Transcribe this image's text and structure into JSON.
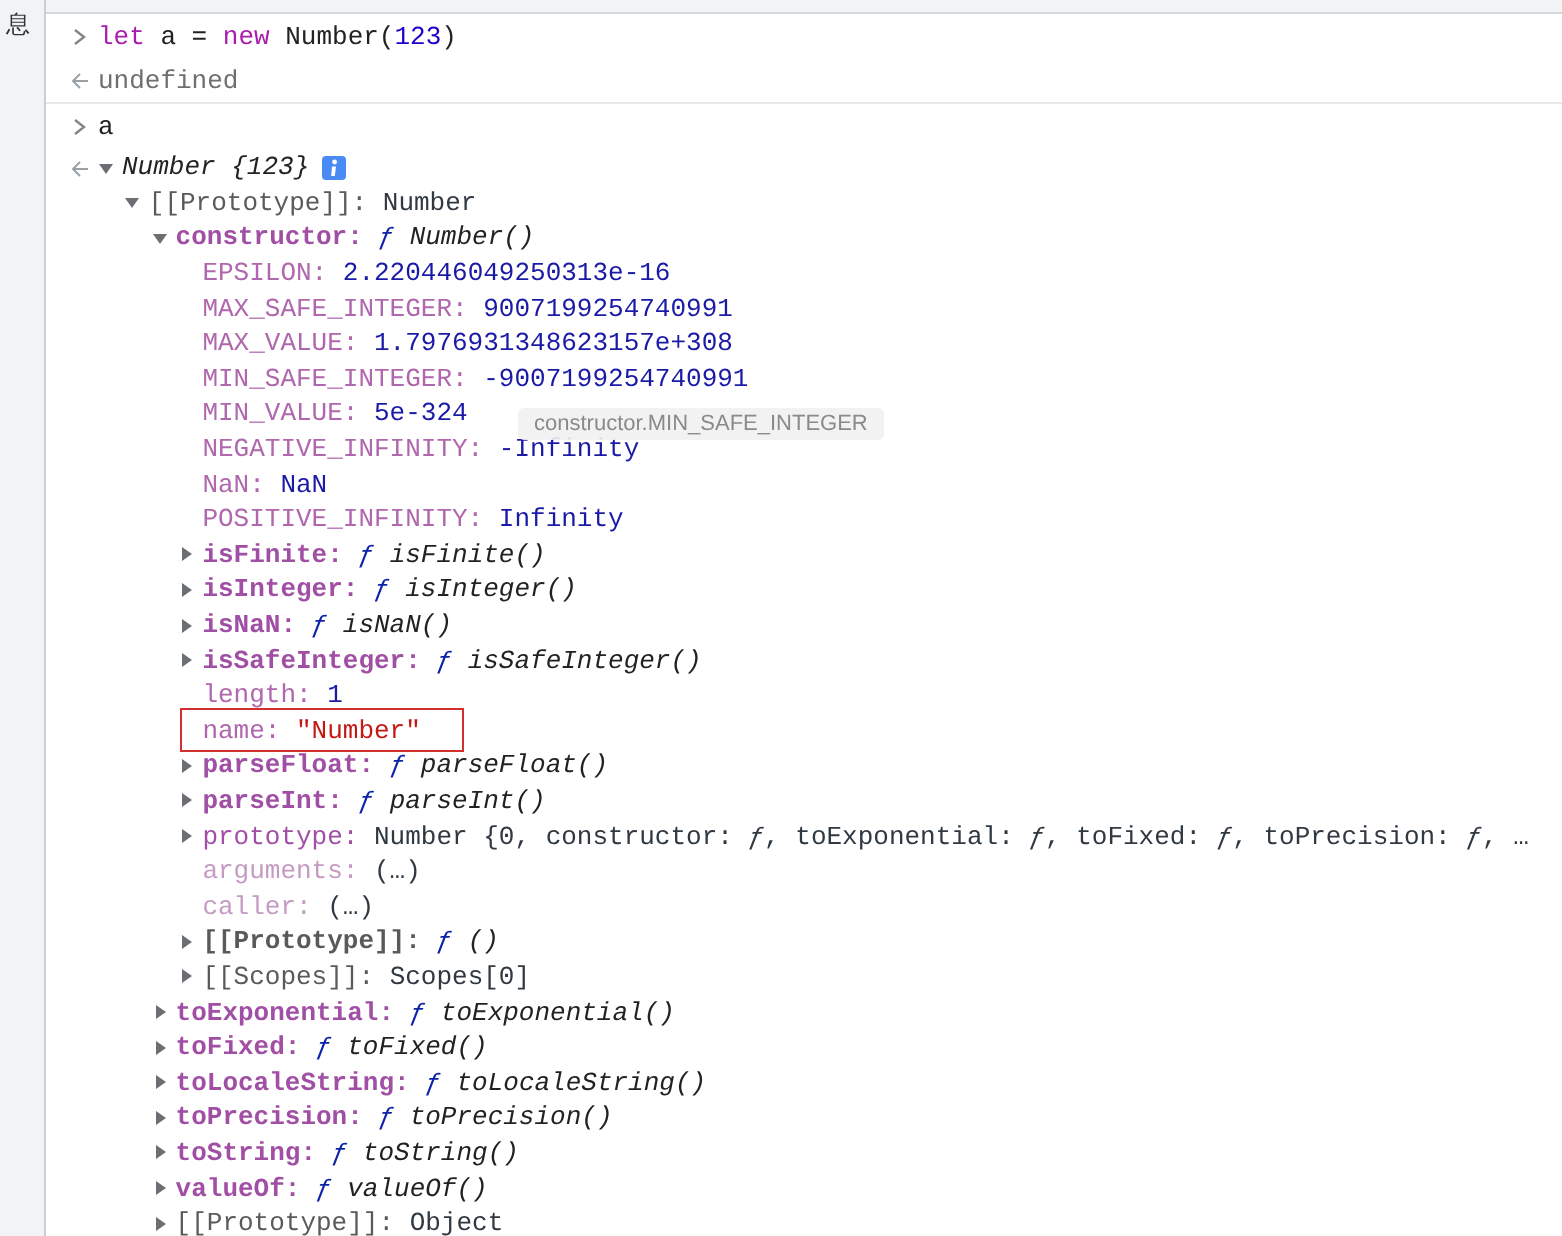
{
  "sidebar": {
    "items": [
      {
        "label": "息"
      }
    ]
  },
  "console": {
    "entries": [
      {
        "kind": "input",
        "tokens": [
          {
            "kind": "keyword",
            "text": "let"
          },
          {
            "kind": "plain",
            "text": " a = "
          },
          {
            "kind": "keyword",
            "text": "new"
          },
          {
            "kind": "plain",
            "text": " Number("
          },
          {
            "kind": "number",
            "text": "123"
          },
          {
            "kind": "plain",
            "text": ")"
          }
        ]
      },
      {
        "kind": "output",
        "text": "undefined"
      },
      {
        "kind": "input",
        "tokens": [
          {
            "kind": "plain",
            "text": "a"
          }
        ]
      },
      {
        "kind": "result",
        "root": {
          "kind": "preview",
          "value": "Number {123}",
          "info": true,
          "expanded": true,
          "highlighted": false,
          "children": [
            {
              "key": "[[Prototype]]:",
              "color": "#5a5a5a",
              "kind": "object",
              "value": "Number",
              "expanded": true,
              "highlighted": false,
              "children": [
                {
                  "key": "constructor:",
                  "color": "#a14fa5",
                  "kind": "function",
                  "prefix": "ƒ",
                  "value": "Number()",
                  "expanded": true,
                  "highlighted": false,
                  "children": [
                    {
                      "key": "EPSILON:",
                      "color": "#b067ad",
                      "kind": "number",
                      "value": "2.220446049250313e-16",
                      "highlighted": false
                    },
                    {
                      "key": "MAX_SAFE_INTEGER:",
                      "color": "#b067ad",
                      "kind": "number",
                      "value": "9007199254740991",
                      "highlighted": false
                    },
                    {
                      "key": "MAX_VALUE:",
                      "color": "#b067ad",
                      "kind": "number",
                      "value": "1.7976931348623157e+308",
                      "highlighted": false
                    },
                    {
                      "key": "MIN_SAFE_INTEGER:",
                      "color": "#b067ad",
                      "kind": "number",
                      "value": "-9007199254740991",
                      "highlighted": false
                    },
                    {
                      "key": "MIN_VALUE:",
                      "color": "#b067ad",
                      "kind": "number",
                      "value": "5e-324",
                      "highlighted": false
                    },
                    {
                      "key": "NEGATIVE_INFINITY:",
                      "color": "#b067ad",
                      "kind": "number",
                      "value": "-Infinity",
                      "highlighted": false
                    },
                    {
                      "key": "NaN:",
                      "color": "#b067ad",
                      "kind": "number",
                      "value": "NaN",
                      "highlighted": false
                    },
                    {
                      "key": "POSITIVE_INFINITY:",
                      "color": "#b067ad",
                      "kind": "number",
                      "value": "Infinity",
                      "highlighted": false
                    },
                    {
                      "key": "isFinite:",
                      "color": "#a14fa5",
                      "kind": "function",
                      "prefix": "ƒ",
                      "value": "isFinite()",
                      "expanded": false,
                      "highlighted": false
                    },
                    {
                      "key": "isInteger:",
                      "color": "#a14fa5",
                      "kind": "function",
                      "prefix": "ƒ",
                      "value": "isInteger()",
                      "expanded": false,
                      "highlighted": false
                    },
                    {
                      "key": "isNaN:",
                      "color": "#a14fa5",
                      "kind": "function",
                      "prefix": "ƒ",
                      "value": "isNaN()",
                      "expanded": false,
                      "highlighted": false
                    },
                    {
                      "key": "isSafeInteger:",
                      "color": "#a14fa5",
                      "kind": "function",
                      "prefix": "ƒ",
                      "value": "isSafeInteger()",
                      "expanded": false,
                      "highlighted": false
                    },
                    {
                      "key": "length:",
                      "color": "#b067ad",
                      "kind": "number",
                      "value": "1",
                      "highlighted": false
                    },
                    {
                      "key": "name:",
                      "color": "#b067ad",
                      "kind": "string",
                      "value": "\"Number\"",
                      "highlighted": true
                    },
                    {
                      "key": "parseFloat:",
                      "color": "#a14fa5",
                      "kind": "function",
                      "prefix": "ƒ",
                      "value": "parseFloat()",
                      "expanded": false,
                      "highlighted": false
                    },
                    {
                      "key": "parseInt:",
                      "color": "#a14fa5",
                      "kind": "function",
                      "prefix": "ƒ",
                      "value": "parseInt()",
                      "expanded": false,
                      "highlighted": false
                    },
                    {
                      "key": "prototype:",
                      "color": "#a14fa5",
                      "kind": "object",
                      "value": "Number {0, constructor: *ƒ*, toExponential: *ƒ*, toFixed: *ƒ*, toPrecision: *ƒ*, …",
                      "expanded": false,
                      "highlighted": false
                    },
                    {
                      "key": "arguments:",
                      "color": "#c69bc3",
                      "kind": "accessor",
                      "value": "(…)",
                      "highlighted": false
                    },
                    {
                      "key": "caller:",
                      "color": "#c69bc3",
                      "kind": "accessor",
                      "value": "(…)",
                      "highlighted": false
                    },
                    {
                      "key": "[[Prototype]]:",
                      "color": "#5a5a5a",
                      "kind": "function",
                      "prefix": "ƒ",
                      "value": "()",
                      "expanded": false,
                      "highlighted": false
                    },
                    {
                      "key": "[[Scopes]]:",
                      "color": "#5a5a5a",
                      "kind": "object",
                      "value": "Scopes[0]",
                      "expanded": false,
                      "highlighted": false
                    }
                  ]
                },
                {
                  "key": "toExponential:",
                  "color": "#a14fa5",
                  "kind": "function",
                  "prefix": "ƒ",
                  "value": "toExponential()",
                  "expanded": false,
                  "highlighted": false
                },
                {
                  "key": "toFixed:",
                  "color": "#a14fa5",
                  "kind": "function",
                  "prefix": "ƒ",
                  "value": "toFixed()",
                  "expanded": false,
                  "highlighted": false
                },
                {
                  "key": "toLocaleString:",
                  "color": "#a14fa5",
                  "kind": "function",
                  "prefix": "ƒ",
                  "value": "toLocaleString()",
                  "expanded": false,
                  "highlighted": false
                },
                {
                  "key": "toPrecision:",
                  "color": "#a14fa5",
                  "kind": "function",
                  "prefix": "ƒ",
                  "value": "toPrecision()",
                  "expanded": false,
                  "highlighted": false
                },
                {
                  "key": "toString:",
                  "color": "#a14fa5",
                  "kind": "function",
                  "prefix": "ƒ",
                  "value": "toString()",
                  "expanded": false,
                  "highlighted": false
                },
                {
                  "key": "valueOf:",
                  "color": "#a14fa5",
                  "kind": "function",
                  "prefix": "ƒ",
                  "value": "valueOf()",
                  "expanded": false,
                  "highlighted": false
                },
                {
                  "key": "[[Prototype]]:",
                  "color": "#5a5a5a",
                  "kind": "object",
                  "value": "Object",
                  "expanded": false,
                  "highlighted": false
                }
              ]
            }
          ]
        }
      }
    ]
  },
  "tooltip": {
    "text": "constructor.MIN_SAFE_INTEGER"
  }
}
